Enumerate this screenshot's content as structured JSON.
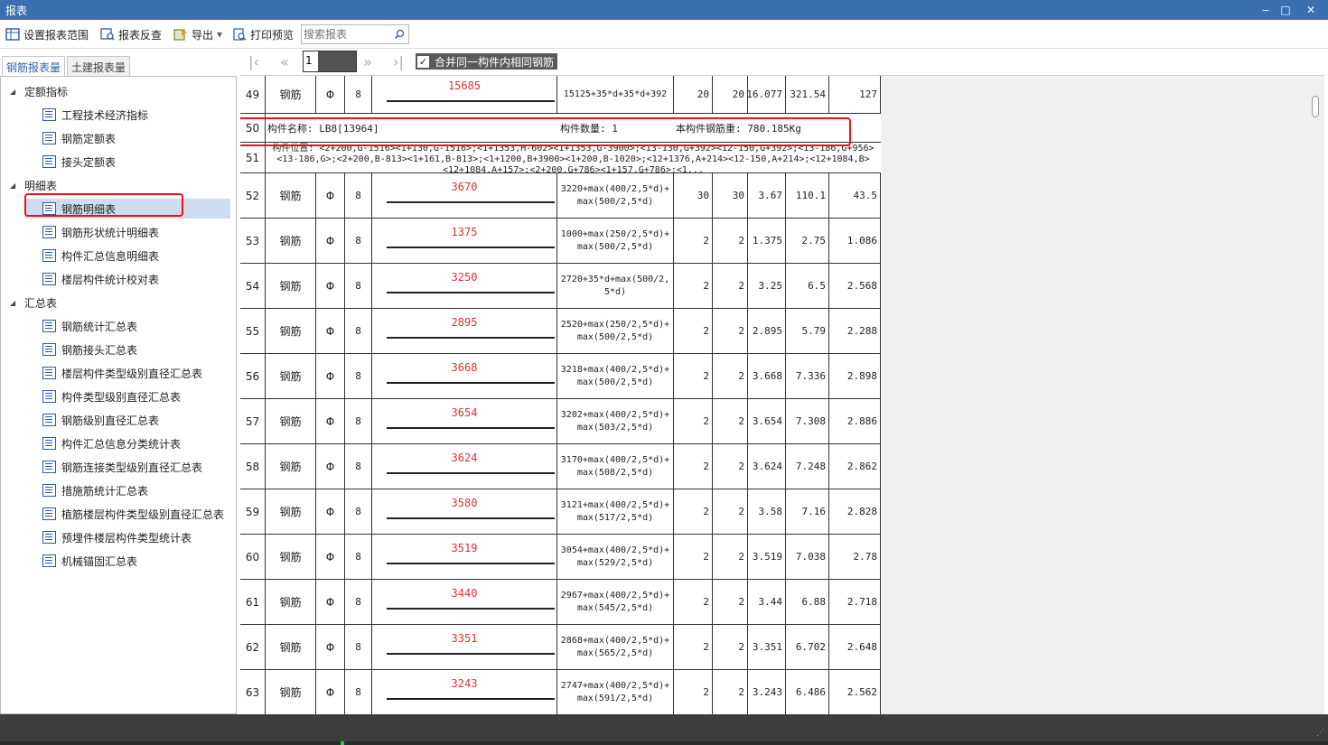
{
  "window": {
    "title": "报表",
    "controls": [
      "‒",
      "□",
      "✕"
    ]
  },
  "toolbar": {
    "set_range": "设置报表范围",
    "reverse_check": "报表反查",
    "export": "导出",
    "print_preview": "打印预览",
    "search_placeholder": "搜索报表"
  },
  "tabs": [
    "钢筋报表量",
    "土建报表量"
  ],
  "tree": {
    "groups": [
      {
        "label": "定额指标",
        "items": [
          "工程技术经济指标",
          "钢筋定额表",
          "接头定额表"
        ]
      },
      {
        "label": "明细表",
        "items": [
          "钢筋明细表",
          "钢筋形状统计明细表",
          "构件汇总信息明细表",
          "楼层构件统计校对表"
        ]
      },
      {
        "label": "汇总表",
        "items": [
          "钢筋统计汇总表",
          "钢筋接头汇总表",
          "楼层构件类型级别直径汇总表",
          "构件类型级别直径汇总表",
          "钢筋级别直径汇总表",
          "构件汇总信息分类统计表",
          "钢筋连接类型级别直径汇总表",
          "措施筋统计汇总表",
          "植筋楼层构件类型级别直径汇总表",
          "预埋件楼层构件类型统计表",
          "机械锚固汇总表"
        ]
      }
    ],
    "selected": "钢筋明细表"
  },
  "nav": {
    "page": "1",
    "merge_label": "合并同一构件内相同钢筋",
    "merge_checked": true
  },
  "rows": [
    {
      "idx": "49",
      "type": "钢筋",
      "grade": "Φ",
      "dia": "8",
      "len": "15685",
      "formula": "15125+35*d+35*d+392",
      "c1": "20",
      "c2": "20",
      "w1": "16.077",
      "w2": "321.54",
      "w3": "127"
    },
    {
      "idx": "50",
      "summary": {
        "name": "构件名称: LB8[13964]",
        "count": "构件数量: 1",
        "weight": "本构件钢筋重: 780.185Kg"
      }
    },
    {
      "idx": "51",
      "position": "构件位置: <2+200,G-1516><1+130,G-1516>;<1+1353,H-602><1+1353,G-3900>;<13-130,G+392><12-150,G+392>;<13-186,G+956><13-186,G>;<2+200,B-813><1+161,B-813>;<1+1200,B+3900><1+200,B-1020>;<12+1376,A+214><12-150,A+214>;<12+1084,B><12+1084,A+157>;<2+200,G+786><1+157,G+786>;<1..."
    },
    {
      "idx": "52",
      "type": "钢筋",
      "grade": "Φ",
      "dia": "8",
      "len": "3670",
      "formula": "3220+max(400/2,5*d)+\nmax(500/2,5*d)",
      "c1": "30",
      "c2": "30",
      "w1": "3.67",
      "w2": "110.1",
      "w3": "43.5"
    },
    {
      "idx": "53",
      "type": "钢筋",
      "grade": "Φ",
      "dia": "8",
      "len": "1375",
      "formula": "1000+max(250/2,5*d)+\nmax(500/2,5*d)",
      "c1": "2",
      "c2": "2",
      "w1": "1.375",
      "w2": "2.75",
      "w3": "1.086"
    },
    {
      "idx": "54",
      "type": "钢筋",
      "grade": "Φ",
      "dia": "8",
      "len": "3250",
      "formula": "2720+35*d+max(500/2,\n5*d)",
      "c1": "2",
      "c2": "2",
      "w1": "3.25",
      "w2": "6.5",
      "w3": "2.568"
    },
    {
      "idx": "55",
      "type": "钢筋",
      "grade": "Φ",
      "dia": "8",
      "len": "2895",
      "formula": "2520+max(250/2,5*d)+\nmax(500/2,5*d)",
      "c1": "2",
      "c2": "2",
      "w1": "2.895",
      "w2": "5.79",
      "w3": "2.288"
    },
    {
      "idx": "56",
      "type": "钢筋",
      "grade": "Φ",
      "dia": "8",
      "len": "3668",
      "formula": "3218+max(400/2,5*d)+\nmax(500/2,5*d)",
      "c1": "2",
      "c2": "2",
      "w1": "3.668",
      "w2": "7.336",
      "w3": "2.898"
    },
    {
      "idx": "57",
      "type": "钢筋",
      "grade": "Φ",
      "dia": "8",
      "len": "3654",
      "formula": "3202+max(400/2,5*d)+\nmax(503/2,5*d)",
      "c1": "2",
      "c2": "2",
      "w1": "3.654",
      "w2": "7.308",
      "w3": "2.886"
    },
    {
      "idx": "58",
      "type": "钢筋",
      "grade": "Φ",
      "dia": "8",
      "len": "3624",
      "formula": "3170+max(400/2,5*d)+\nmax(508/2,5*d)",
      "c1": "2",
      "c2": "2",
      "w1": "3.624",
      "w2": "7.248",
      "w3": "2.862"
    },
    {
      "idx": "59",
      "type": "钢筋",
      "grade": "Φ",
      "dia": "8",
      "len": "3580",
      "formula": "3121+max(400/2,5*d)+\nmax(517/2,5*d)",
      "c1": "2",
      "c2": "2",
      "w1": "3.58",
      "w2": "7.16",
      "w3": "2.828"
    },
    {
      "idx": "60",
      "type": "钢筋",
      "grade": "Φ",
      "dia": "8",
      "len": "3519",
      "formula": "3054+max(400/2,5*d)+\nmax(529/2,5*d)",
      "c1": "2",
      "c2": "2",
      "w1": "3.519",
      "w2": "7.038",
      "w3": "2.78"
    },
    {
      "idx": "61",
      "type": "钢筋",
      "grade": "Φ",
      "dia": "8",
      "len": "3440",
      "formula": "2967+max(400/2,5*d)+\nmax(545/2,5*d)",
      "c1": "2",
      "c2": "2",
      "w1": "3.44",
      "w2": "6.88",
      "w3": "2.718"
    },
    {
      "idx": "62",
      "type": "钢筋",
      "grade": "Φ",
      "dia": "8",
      "len": "3351",
      "formula": "2868+max(400/2,5*d)+\nmax(565/2,5*d)",
      "c1": "2",
      "c2": "2",
      "w1": "3.351",
      "w2": "6.702",
      "w3": "2.648"
    },
    {
      "idx": "63",
      "type": "钢筋",
      "grade": "Φ",
      "dia": "8",
      "len": "3243",
      "formula": "2747+max(400/2,5*d)+\nmax(591/2,5*d)",
      "c1": "2",
      "c2": "2",
      "w1": "3.243",
      "w2": "6.486",
      "w3": "2.562"
    }
  ],
  "colors": {
    "titlebar": "#3c6fb0",
    "accent_red": "#e11",
    "selected_bg": "#cfdcf0",
    "length_text": "#e03030"
  }
}
